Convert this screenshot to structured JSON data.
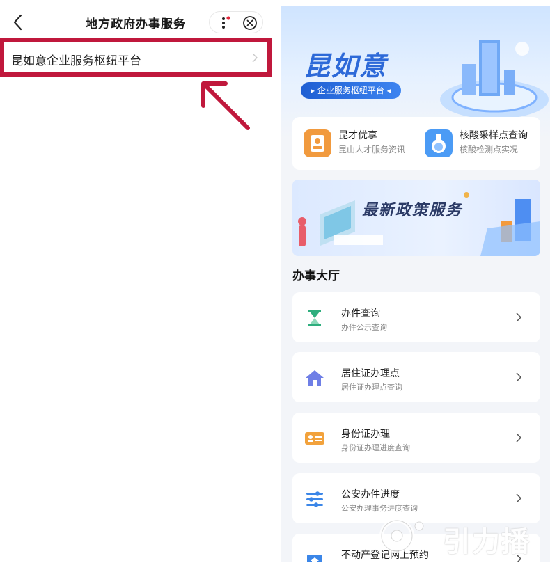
{
  "left_screen": {
    "title": "地方政府办事服务",
    "search_result": "昆如意企业服务枢纽平台",
    "highlight_color": "#c0183c"
  },
  "right_screen": {
    "brand": "昆如意",
    "brand_subtitle": "企业服务枢纽平台",
    "quick_links": [
      {
        "title": "昆才优享",
        "subtitle": "昆山人才服务资讯",
        "icon": "person-card-icon"
      },
      {
        "title": "核酸采样点查询",
        "subtitle": "核酸检测点实况",
        "icon": "flask-icon"
      }
    ],
    "banner_text": "最新政策服务",
    "section_title": "办事大厅",
    "services": [
      {
        "title": "办件查询",
        "subtitle": "办件公示查询",
        "icon": "hourglass-icon"
      },
      {
        "title": "居住证办理点",
        "subtitle": "居住证办理点查询",
        "icon": "house-icon"
      },
      {
        "title": "身份证办理",
        "subtitle": "身份证办理进度查询",
        "icon": "id-card-icon"
      },
      {
        "title": "公安办件进度",
        "subtitle": "公安办理事务进度查询",
        "icon": "sliders-icon"
      },
      {
        "title": "不动产登记网上预约",
        "subtitle": "",
        "icon": "building-icon"
      }
    ]
  },
  "watermark": "引力播"
}
